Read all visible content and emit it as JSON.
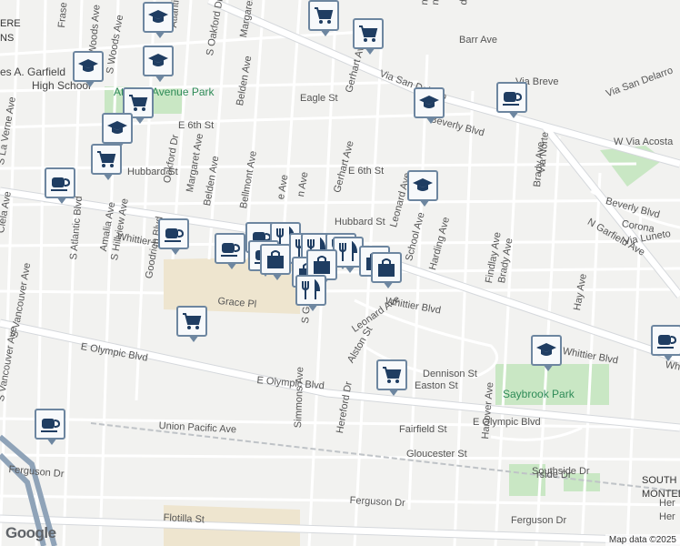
{
  "streets": [
    {
      "name": "Frase",
      "rot": -85
    },
    {
      "name": "Atlantic",
      "rot": -85
    },
    {
      "name": "S Woods Ave",
      "rot": -80
    },
    {
      "name": "S Oakford Dr",
      "rot": -80
    },
    {
      "name": "Margaret Ave",
      "rot": -80
    },
    {
      "name": "Belden Ave",
      "rot": -80
    },
    {
      "name": "Eagle St",
      "rot": 0
    },
    {
      "name": "E 6th St",
      "rot": 0
    },
    {
      "name": "E 6th St",
      "rot": 0
    },
    {
      "name": "Hubbard St",
      "rot": 0
    },
    {
      "name": "Hubbard St",
      "rot": 0
    },
    {
      "name": "S La Verne Ave",
      "rot": -80
    },
    {
      "name": "Oakford Dr",
      "rot": -80
    },
    {
      "name": "Margaret Ave",
      "rot": -80
    },
    {
      "name": "Belden Ave",
      "rot": -80
    },
    {
      "name": "Bellmont Ave",
      "rot": -80
    },
    {
      "name": "Clela Ave",
      "rot": -80
    },
    {
      "name": "S Vancouver Ave",
      "rot": -80
    },
    {
      "name": "S Atlantic Blvd",
      "rot": -85
    },
    {
      "name": "Amalia Ave",
      "rot": -80
    },
    {
      "name": "S Hillview Ave",
      "rot": -80
    },
    {
      "name": "Goodrich Blvd",
      "rot": -80
    },
    {
      "name": "Whittier Blvd",
      "rot": 10
    },
    {
      "name": "Whittier Blvd",
      "rot": 10
    },
    {
      "name": "Whittier Blvd",
      "rot": 10
    },
    {
      "name": "Grace Pl",
      "rot": 5
    },
    {
      "name": "Gerhart Ave",
      "rot": -75
    },
    {
      "name": "Via San Delarro",
      "rot": 20
    },
    {
      "name": "Barr Ave",
      "rot": 0
    },
    {
      "name": "Via Breve",
      "rot": 0
    },
    {
      "name": "Via San Delarro",
      "rot": -20
    },
    {
      "name": "Beverly Blvd",
      "rot": 15
    },
    {
      "name": "W Via Acosta",
      "rot": 0
    },
    {
      "name": "Brady Ave",
      "rot": -85
    },
    {
      "name": "Via Norte",
      "rot": -85
    },
    {
      "name": "Beverly Blvd",
      "rot": 15
    },
    {
      "name": "Corona",
      "rot": 10
    },
    {
      "name": "Via Luneto",
      "rot": -10
    },
    {
      "name": "N Garfield Ave",
      "rot": 30
    },
    {
      "name": "School Ave",
      "rot": -75
    },
    {
      "name": "Harding Ave",
      "rot": -75
    },
    {
      "name": "Findlay Ave",
      "rot": -80
    },
    {
      "name": "Brady Ave",
      "rot": -80
    },
    {
      "name": "Hay Ave",
      "rot": -80
    },
    {
      "name": "Leonard Ave",
      "rot": -35
    },
    {
      "name": "Alston St",
      "rot": -60
    },
    {
      "name": "Dennison St",
      "rot": 0
    },
    {
      "name": "Easton St",
      "rot": 0
    },
    {
      "name": "E Olympic Blvd",
      "rot": 10
    },
    {
      "name": "E Olympic Blvd",
      "rot": 5
    },
    {
      "name": "E Olympic Blvd",
      "rot": 0
    },
    {
      "name": "Simmons Ave",
      "rot": -88
    },
    {
      "name": "Hereford Dr",
      "rot": -80
    },
    {
      "name": "S Gerhart",
      "rot": -85
    },
    {
      "name": "Union Pacific Ave",
      "rot": 3
    },
    {
      "name": "Fairfield St",
      "rot": 0
    },
    {
      "name": "Gloucester St",
      "rot": 0
    },
    {
      "name": "Hanover Ave",
      "rot": -85
    },
    {
      "name": "Southside Dr",
      "rot": 0
    },
    {
      "name": "Ferguson Dr",
      "rot": 5
    },
    {
      "name": "Ferguson Dr",
      "rot": 3
    },
    {
      "name": "Ferguson Dr",
      "rot": 0
    },
    {
      "name": "Flotilla St",
      "rot": 3
    },
    {
      "name": "S Woods Ave",
      "rot": -85
    },
    {
      "name": "Whittier Blvd",
      "rot": 10
    },
    {
      "name": "S Vancouver Ave",
      "rot": -80
    },
    {
      "name": "Her",
      "rot": 0
    },
    {
      "name": "Her",
      "rot": 0
    },
    {
      "name": "Leonard Ave",
      "rot": -75
    },
    {
      "name": "nshave St",
      "rot": -85
    },
    {
      "name": "d St",
      "rot": -85
    },
    {
      "name": "n St",
      "rot": -85
    },
    {
      "name": "Gerhart Ave",
      "rot": -75
    },
    {
      "name": "n Ave",
      "rot": -80
    },
    {
      "name": "e Ave",
      "rot": -80
    },
    {
      "name": "rside Dr",
      "rot": 0
    }
  ],
  "pois": [
    {
      "name": "Saybrook Park",
      "kind": "park"
    },
    {
      "name": "Atlantic Avenue Park",
      "kind": "park"
    },
    {
      "name": "es A. Garfield",
      "kind": "school"
    },
    {
      "name": "High School",
      "kind": "school"
    },
    {
      "name": "SOUTH",
      "kind": "area"
    },
    {
      "name": "MONTEBE",
      "kind": "area"
    },
    {
      "name": "ERE",
      "kind": "area"
    },
    {
      "name": "NS",
      "kind": "area"
    }
  ],
  "markers": [
    {
      "type": "school",
      "icon": "graduation-cap-icon"
    },
    {
      "type": "shopping",
      "icon": "shopping-cart-icon"
    },
    {
      "type": "school",
      "icon": "graduation-cap-icon"
    },
    {
      "type": "shopping",
      "icon": "shopping-cart-icon"
    },
    {
      "type": "school",
      "icon": "graduation-cap-icon"
    },
    {
      "type": "school",
      "icon": "graduation-cap-icon"
    },
    {
      "type": "shopping",
      "icon": "shopping-cart-icon"
    },
    {
      "type": "school",
      "icon": "graduation-cap-icon"
    },
    {
      "type": "cafe",
      "icon": "coffee-cup-icon"
    },
    {
      "type": "shopping",
      "icon": "shopping-cart-icon"
    },
    {
      "type": "cafe",
      "icon": "coffee-cup-icon"
    },
    {
      "type": "school",
      "icon": "graduation-cap-icon"
    },
    {
      "type": "school",
      "icon": "graduation-cap-icon"
    },
    {
      "type": "cafe",
      "icon": "coffee-cup-icon"
    },
    {
      "type": "cafe",
      "icon": "coffee-cup-icon"
    },
    {
      "type": "cafe",
      "icon": "coffee-cup-icon"
    },
    {
      "type": "restaurant",
      "icon": "fork-knife-icon"
    },
    {
      "type": "restaurant",
      "icon": "fork-knife-icon"
    },
    {
      "type": "cafe",
      "icon": "coffee-cup-icon"
    },
    {
      "type": "shopping",
      "icon": "shopping-bag-icon"
    },
    {
      "type": "restaurant",
      "icon": "fork-knife-icon"
    },
    {
      "type": "restaurant",
      "icon": "fork-knife-icon"
    },
    {
      "type": "restaurant",
      "icon": "fork-knife-icon"
    },
    {
      "type": "shopping",
      "icon": "shopping-bag-icon"
    },
    {
      "type": "shopping",
      "icon": "shopping-bag-icon"
    },
    {
      "type": "shopping",
      "icon": "shopping-bag-icon"
    },
    {
      "type": "restaurant",
      "icon": "fork-knife-icon"
    },
    {
      "type": "shopping",
      "icon": "shopping-bag-icon"
    },
    {
      "type": "shopping",
      "icon": "shopping-cart-icon"
    },
    {
      "type": "school",
      "icon": "graduation-cap-icon"
    },
    {
      "type": "cafe",
      "icon": "coffee-cup-icon"
    },
    {
      "type": "shopping",
      "icon": "shopping-cart-icon"
    },
    {
      "type": "cafe",
      "icon": "coffee-cup-icon"
    }
  ],
  "footer": {
    "logo": "Google",
    "attribution": "Map data ©2025"
  },
  "colors": {
    "road": "#ffffff",
    "road_outline": "#d5d8dc",
    "background": "#f2f2f0",
    "park": "#c9e7c4",
    "industrial": "#eee5cf",
    "marker_border": "#6d86a0",
    "marker_fill": "#f7f9fb",
    "icon": "#1f3d62"
  }
}
